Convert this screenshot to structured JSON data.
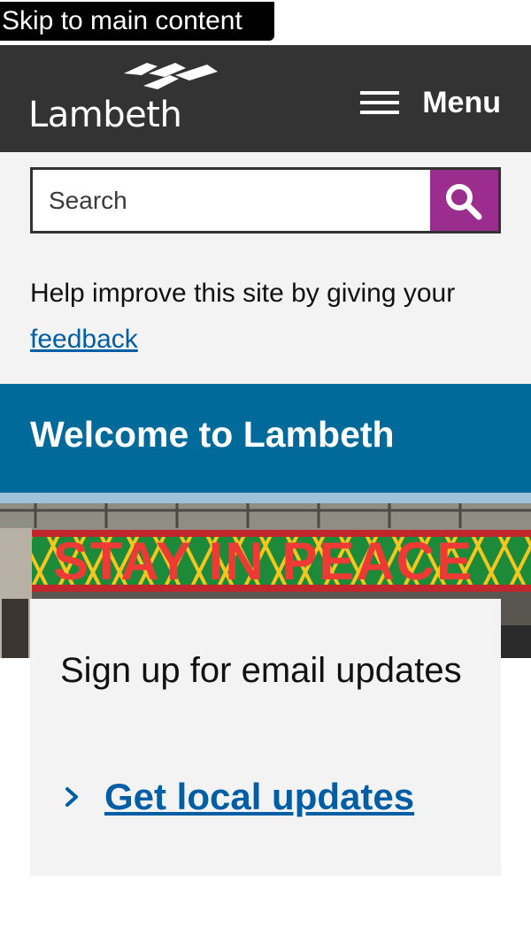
{
  "skip_link": "Skip to main content",
  "header": {
    "logo_text": "Lambeth",
    "menu_label": "Menu"
  },
  "search": {
    "placeholder": "Search"
  },
  "feedback": {
    "prefix": "Help improve this site by giving your ",
    "link": "feedback"
  },
  "welcome": {
    "title": "Welcome to Lambeth"
  },
  "hero": {
    "sign_text": "STAY IN PEACE"
  },
  "email_card": {
    "title": "Sign up for email updates",
    "link": "Get local updates"
  },
  "colors": {
    "header": "#333333",
    "search_button": "#9a2d8e",
    "welcome": "#006a9a",
    "link": "#005ea5",
    "band": "#f3f3f3"
  }
}
